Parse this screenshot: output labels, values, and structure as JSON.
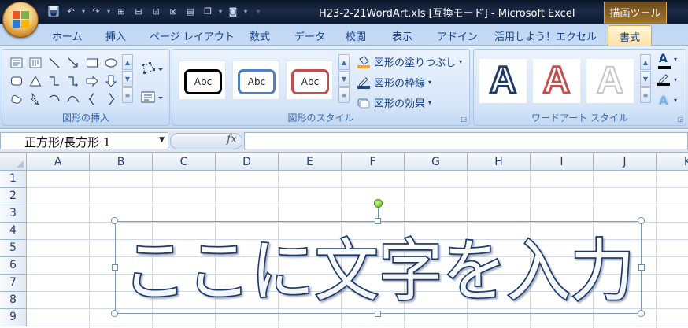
{
  "title_bar": {
    "window_title": "H23-2-21WordArt.xls  [互換モード] - Microsoft Excel",
    "context_tool": "描画ツール"
  },
  "tabs": [
    "ホーム",
    "挿入",
    "ページ レイアウト",
    "数式",
    "データ",
    "校閲",
    "表示",
    "アドイン",
    "活用しよう！エクセル",
    "書式"
  ],
  "active_tab": "書式",
  "ribbon": {
    "insert_shapes_label": "図形の挿入",
    "shape_styles_label": "図形のスタイル",
    "style_sample_text": "Abc",
    "style_samples": [
      {
        "border_color": "#000000"
      },
      {
        "border_color": "#4f81bd"
      },
      {
        "border_color": "#c0504d"
      }
    ],
    "shape_fill": "図形の塗りつぶし",
    "shape_outline": "図形の枠線",
    "shape_effects": "図形の効果",
    "wordart_styles_label": "ワードアート スタイル",
    "wordart_sample_letter": "A"
  },
  "formula_bar": {
    "name_box": "正方形/長方形 1",
    "fx": "fx",
    "formula": ""
  },
  "sheet": {
    "columns": [
      "A",
      "B",
      "C",
      "D",
      "E",
      "F",
      "G",
      "H",
      "I",
      "J",
      "K"
    ],
    "rows": [
      "1",
      "2",
      "3",
      "4",
      "5",
      "6",
      "7",
      "8",
      "9"
    ]
  },
  "wordart": {
    "text": "ここに文字を入力",
    "outline_color": "#1f3a68",
    "fill_color": "#ffffff"
  },
  "colors": {
    "ribbon_text": "#15428b",
    "active_tab_fill": "#ffe0a0"
  }
}
